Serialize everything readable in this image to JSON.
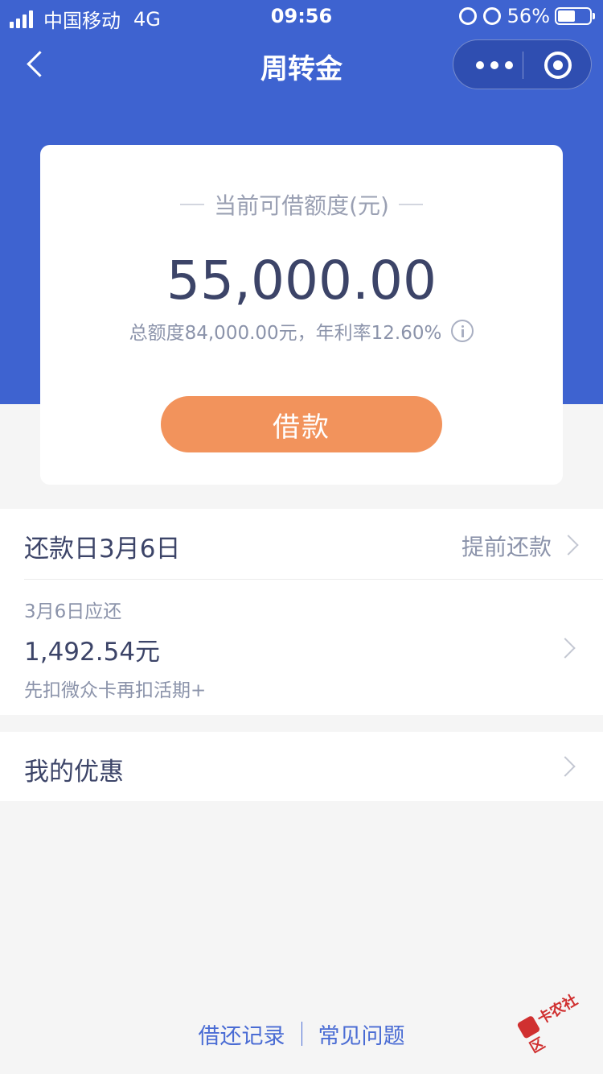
{
  "status_bar": {
    "carrier": "中国移动",
    "network": "4G",
    "time": "09:56",
    "battery": "56%",
    "battery_level": 0.56
  },
  "nav": {
    "title": "周转金"
  },
  "credit": {
    "label": "当前可借额度(元)",
    "amount": "55,000.00",
    "detail": "总额度84,000.00元，年利率12.60%",
    "borrow_button": "借款"
  },
  "repayment": {
    "title": "还款日3月6日",
    "prepay_link": "提前还款",
    "due_label": "3月6日应还",
    "due_amount": "1,492.54元",
    "deduction_note": "先扣微众卡再扣活期+"
  },
  "offers": {
    "label": "我的优惠"
  },
  "footer": {
    "records_link": "借还记录",
    "faq_link": "常见问题"
  },
  "watermark": {
    "text": "卡农社区"
  },
  "colors": {
    "header_blue": "#3e63d0",
    "button_orange": "#f2935c",
    "link_blue": "#4a6cd4",
    "text_dark": "#3c4468"
  }
}
